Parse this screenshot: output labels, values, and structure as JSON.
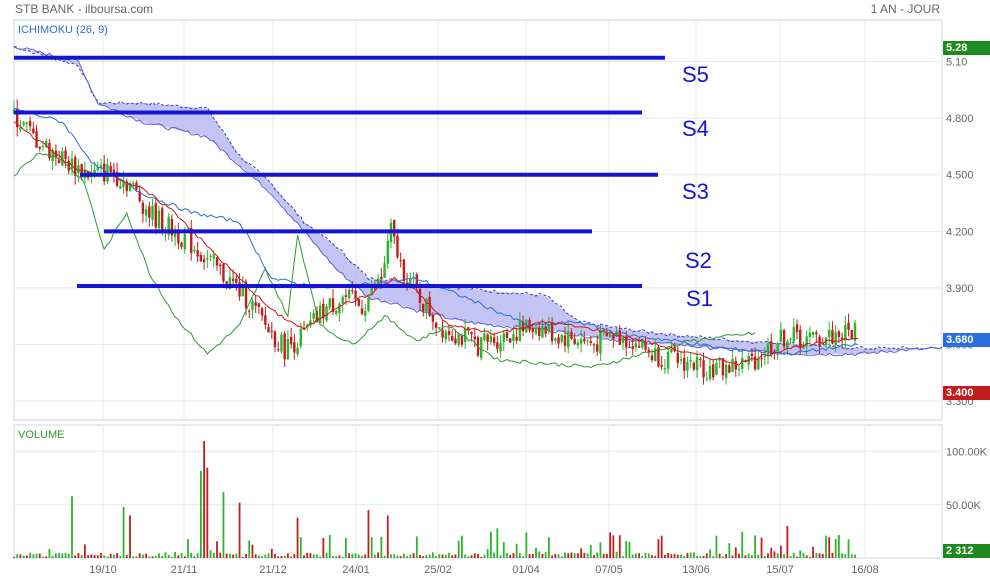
{
  "header": {
    "left_title": "STB BANK - ilboursa.com",
    "right_period": "1 AN - JOUR"
  },
  "panels": {
    "price_label": "ICHIMOKU (26, 9)",
    "volume_label": "VOLUME"
  },
  "price_axis": {
    "ticks": [
      "5.10",
      "4.800",
      "4.500",
      "4.200",
      "3.900",
      "3.600",
      "3.300"
    ],
    "ticks_values": [
      5.1,
      4.8,
      4.5,
      4.2,
      3.9,
      3.6,
      3.3
    ]
  },
  "volume_axis": {
    "ticks": [
      "100.00K",
      "50.00K"
    ],
    "ticks_values": [
      100000,
      50000
    ]
  },
  "tags": {
    "max": {
      "text": "5.28",
      "color": "#1c8a1c"
    },
    "last": {
      "text": "3.680",
      "color": "#2a6fe0"
    },
    "min": {
      "text": "3.400",
      "color": "#c21d1d"
    },
    "volume_last": {
      "text": "2 312",
      "color": "#1c8a1c"
    }
  },
  "x_axis": {
    "labels": [
      "19/10",
      "21/11",
      "21/12",
      "24/01",
      "25/02",
      "01/04",
      "07/05",
      "13/06",
      "15/07",
      "16/08"
    ]
  },
  "support_lines": [
    {
      "label": "S5",
      "price": 5.12
    },
    {
      "label": "S4",
      "price": 4.83
    },
    {
      "label": "S3",
      "price": 4.5
    },
    {
      "label": "S2",
      "price": 4.2
    },
    {
      "label": "S1",
      "price": 3.91
    }
  ],
  "colors": {
    "up": "#2bb52b",
    "down": "#c21d1d",
    "cloud": "#b9baf2",
    "support": "#1414d4",
    "tenkan": "#d01818",
    "kijun": "#2a6fd0",
    "chikou": "#2f9a2f"
  },
  "chart_data": {
    "type": "candlestick",
    "title": "STB BANK - ilboursa.com",
    "indicator": "ICHIMOKU (26, 9)",
    "period": "1 AN - JOUR",
    "ylim": [
      3.2,
      5.32
    ],
    "y_ticks": [
      5.1,
      4.8,
      4.5,
      4.2,
      3.9,
      3.6,
      3.3
    ],
    "x_labels": [
      "19/10",
      "21/11",
      "21/12",
      "24/01",
      "25/02",
      "01/04",
      "07/05",
      "13/06",
      "15/07",
      "16/08"
    ],
    "price_path": [
      [
        0,
        4.82
      ],
      [
        6,
        4.7
      ],
      [
        12,
        4.62
      ],
      [
        18,
        4.55
      ],
      [
        24,
        4.5
      ],
      [
        30,
        4.52
      ],
      [
        36,
        4.45
      ],
      [
        42,
        4.3
      ],
      [
        48,
        4.22
      ],
      [
        54,
        4.15
      ],
      [
        60,
        4.05
      ],
      [
        66,
        3.95
      ],
      [
        72,
        3.85
      ],
      [
        78,
        3.7
      ],
      [
        84,
        3.58
      ],
      [
        90,
        3.65
      ],
      [
        96,
        3.78
      ],
      [
        102,
        3.85
      ],
      [
        108,
        3.8
      ],
      [
        114,
        3.95
      ],
      [
        117,
        4.2
      ],
      [
        120,
        4.02
      ],
      [
        126,
        3.85
      ],
      [
        132,
        3.7
      ],
      [
        138,
        3.65
      ],
      [
        144,
        3.6
      ],
      [
        150,
        3.63
      ],
      [
        156,
        3.67
      ],
      [
        162,
        3.7
      ],
      [
        168,
        3.65
      ],
      [
        174,
        3.63
      ],
      [
        180,
        3.6
      ],
      [
        186,
        3.65
      ],
      [
        192,
        3.62
      ],
      [
        198,
        3.55
      ],
      [
        204,
        3.52
      ],
      [
        210,
        3.5
      ],
      [
        216,
        3.47
      ],
      [
        222,
        3.48
      ],
      [
        228,
        3.5
      ],
      [
        234,
        3.58
      ],
      [
        240,
        3.65
      ],
      [
        246,
        3.62
      ],
      [
        252,
        3.64
      ],
      [
        258,
        3.66
      ],
      [
        262,
        3.68
      ]
    ],
    "ichimoku": {
      "tenkan": [
        [
          0,
          4.78
        ],
        [
          10,
          4.65
        ],
        [
          20,
          4.52
        ],
        [
          30,
          4.5
        ],
        [
          40,
          4.42
        ],
        [
          50,
          4.3
        ],
        [
          60,
          4.12
        ],
        [
          70,
          3.95
        ],
        [
          80,
          3.78
        ],
        [
          90,
          3.68
        ],
        [
          100,
          3.8
        ],
        [
          110,
          3.86
        ],
        [
          118,
          3.95
        ],
        [
          125,
          3.88
        ],
        [
          135,
          3.7
        ],
        [
          150,
          3.66
        ],
        [
          165,
          3.72
        ],
        [
          180,
          3.68
        ],
        [
          195,
          3.62
        ],
        [
          210,
          3.55
        ],
        [
          225,
          3.5
        ],
        [
          240,
          3.58
        ],
        [
          255,
          3.62
        ],
        [
          262,
          3.64
        ]
      ],
      "kijun": [
        [
          0,
          4.85
        ],
        [
          15,
          4.78
        ],
        [
          25,
          4.55
        ],
        [
          40,
          4.4
        ],
        [
          55,
          4.3
        ],
        [
          70,
          4.25
        ],
        [
          80,
          3.95
        ],
        [
          95,
          3.9
        ],
        [
          110,
          3.92
        ],
        [
          125,
          3.95
        ],
        [
          140,
          3.85
        ],
        [
          160,
          3.7
        ],
        [
          175,
          3.72
        ],
        [
          190,
          3.65
        ],
        [
          205,
          3.62
        ],
        [
          220,
          3.58
        ],
        [
          240,
          3.55
        ],
        [
          262,
          3.6
        ]
      ],
      "chikou": [
        [
          0,
          4.5
        ],
        [
          8,
          4.62
        ],
        [
          15,
          4.58
        ],
        [
          22,
          4.45
        ],
        [
          28,
          4.1
        ],
        [
          35,
          4.3
        ],
        [
          42,
          3.98
        ],
        [
          50,
          3.75
        ],
        [
          60,
          3.55
        ],
        [
          70,
          3.7
        ],
        [
          78,
          4.0
        ],
        [
          85,
          3.75
        ],
        [
          88,
          4.18
        ],
        [
          95,
          3.7
        ],
        [
          105,
          3.6
        ],
        [
          115,
          3.75
        ],
        [
          125,
          3.62
        ],
        [
          135,
          3.7
        ],
        [
          150,
          3.52
        ],
        [
          165,
          3.5
        ],
        [
          180,
          3.48
        ],
        [
          195,
          3.55
        ],
        [
          210,
          3.62
        ],
        [
          220,
          3.64
        ],
        [
          230,
          3.66
        ]
      ],
      "senkou_a": [
        [
          0,
          5.18
        ],
        [
          20,
          5.08
        ],
        [
          26,
          4.88
        ],
        [
          40,
          4.88
        ],
        [
          60,
          4.85
        ],
        [
          70,
          4.6
        ],
        [
          80,
          4.45
        ],
        [
          90,
          4.25
        ],
        [
          100,
          4.12
        ],
        [
          110,
          3.95
        ],
        [
          118,
          3.94
        ],
        [
          125,
          3.92
        ],
        [
          140,
          3.9
        ],
        [
          150,
          3.88
        ],
        [
          165,
          3.86
        ],
        [
          175,
          3.72
        ],
        [
          190,
          3.68
        ],
        [
          205,
          3.65
        ],
        [
          225,
          3.62
        ],
        [
          245,
          3.6
        ],
        [
          262,
          3.58
        ],
        [
          288,
          3.58
        ]
      ],
      "senkou_b": [
        [
          0,
          5.18
        ],
        [
          20,
          5.1
        ],
        [
          26,
          4.88
        ],
        [
          40,
          4.78
        ],
        [
          60,
          4.7
        ],
        [
          70,
          4.55
        ],
        [
          80,
          4.4
        ],
        [
          90,
          4.2
        ],
        [
          100,
          4.0
        ],
        [
          110,
          3.85
        ],
        [
          118,
          3.82
        ],
        [
          125,
          3.78
        ],
        [
          140,
          3.72
        ],
        [
          150,
          3.7
        ],
        [
          165,
          3.68
        ],
        [
          175,
          3.65
        ],
        [
          190,
          3.62
        ],
        [
          205,
          3.6
        ],
        [
          225,
          3.57
        ],
        [
          245,
          3.55
        ],
        [
          262,
          3.55
        ],
        [
          275,
          3.57
        ],
        [
          288,
          3.58
        ]
      ]
    },
    "support_levels": [
      5.12,
      4.83,
      4.5,
      4.2,
      3.91
    ],
    "volume": {
      "ylim": [
        0,
        125000
      ],
      "spikes": [
        [
          18,
          58000
        ],
        [
          34,
          48000
        ],
        [
          36,
          40000
        ],
        [
          58,
          82000
        ],
        [
          59,
          110000
        ],
        [
          60,
          85000
        ],
        [
          65,
          62000
        ],
        [
          70,
          52000
        ],
        [
          88,
          38000
        ],
        [
          110,
          45000
        ],
        [
          116,
          40000
        ],
        [
          150,
          28000
        ],
        [
          185,
          24000
        ],
        [
          240,
          30000
        ],
        [
          255,
          18000
        ]
      ],
      "base_range": [
        1000,
        12000
      ]
    }
  }
}
